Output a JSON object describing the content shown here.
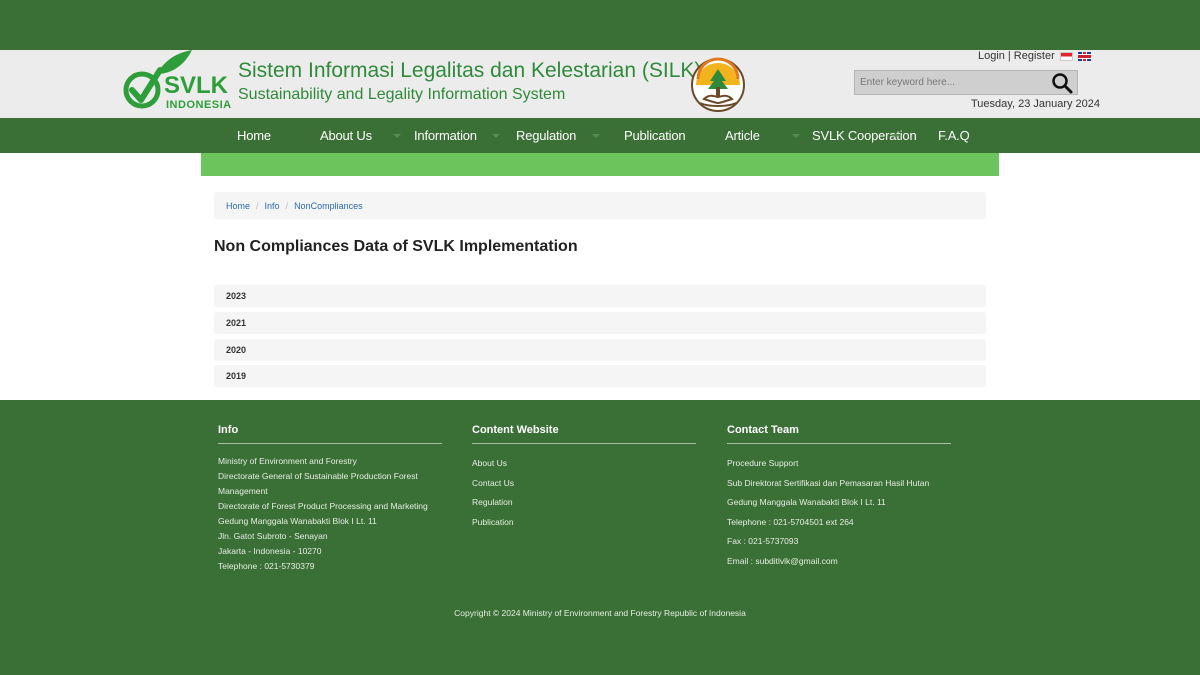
{
  "header": {
    "logo_text": "SVLK",
    "logo_subtext": "INDONESIA",
    "title": "Sistem Informasi Legalitas dan Kelestarian (SILK)",
    "subtitle": "Sustainability and Legality Information System",
    "login_label": "Login",
    "auth_separator": "|",
    "register_label": "Register",
    "search_placeholder": "Enter keyword here...",
    "date": "Tuesday, 23 January 2024"
  },
  "nav": {
    "items": [
      {
        "label": "Home"
      },
      {
        "label": "About Us"
      },
      {
        "label": "Information"
      },
      {
        "label": "Regulation"
      },
      {
        "label": "Publication"
      },
      {
        "label": "Article"
      },
      {
        "label": "SVLK Cooperation"
      },
      {
        "label": "F.A.Q"
      }
    ]
  },
  "breadcrumb": {
    "items": [
      "Home",
      "Info",
      "NonCompliances"
    ],
    "separator": "/"
  },
  "main": {
    "title": "Non Compliances Data of SVLK Implementation",
    "years": [
      "2023",
      "2021",
      "2020",
      "2019"
    ]
  },
  "footer": {
    "info": {
      "heading": "Info",
      "lines": [
        "Ministry of Environment and Forestry",
        "Directorate General of Sustainable Production Forest",
        "Management",
        "Directorate of Forest Product Processing and Marketing",
        "Gedung Manggala Wanabakti Blok I Lt. 11",
        "Jln. Gatot Subroto - Senayan",
        "Jakarta - Indonesia - 10270",
        "Telephone : 021-5730379"
      ]
    },
    "content_website": {
      "heading": "Content Website",
      "links": [
        "About Us",
        "Contact Us",
        "Regulation",
        "Publication"
      ]
    },
    "contact_team": {
      "heading": "Contact Team",
      "lines": [
        "Procedure Support",
        "Sub Direktorat Sertifikasi dan Pemasaran Hasil Hutan",
        "Gedung Manggala Wanabakti Blok I Lt. 11",
        "Telephone : 021-5704501 ext 264",
        "Fax : 021-5737093",
        "Email : subditlvlk@gmail.com"
      ]
    },
    "copyright": "Copyright © 2024 Ministry of Environment and Forestry Republic of Indonesia"
  },
  "colors": {
    "dark_green": "#3a6f35",
    "light_green": "#6cc45c",
    "brand_green": "#2e9e3a",
    "link_blue": "#2a6ab0"
  },
  "icons": [
    "logo-check-leaf-icon",
    "ministry-emblem-icon",
    "indonesia-flag-icon",
    "uk-flag-icon",
    "search-icon",
    "caret-down-icon"
  ]
}
